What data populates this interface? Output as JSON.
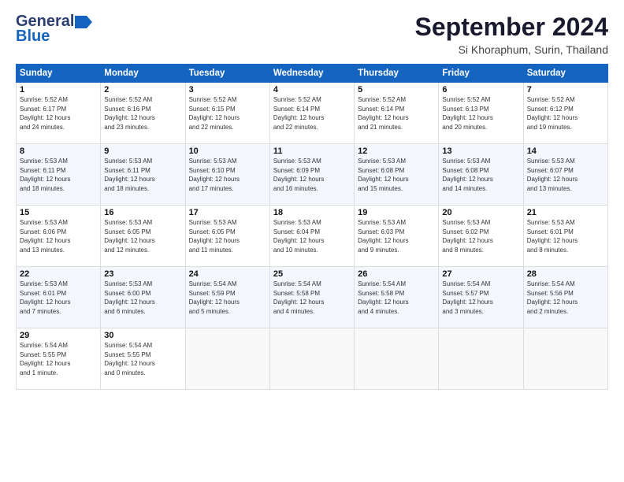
{
  "header": {
    "logo_general": "General",
    "logo_blue": "Blue",
    "month": "September 2024",
    "location": "Si Khoraphum, Surin, Thailand"
  },
  "weekdays": [
    "Sunday",
    "Monday",
    "Tuesday",
    "Wednesday",
    "Thursday",
    "Friday",
    "Saturday"
  ],
  "weeks": [
    [
      {
        "day": "1",
        "sunrise": "5:52 AM",
        "sunset": "6:17 PM",
        "daylight": "12 hours and 24 minutes."
      },
      {
        "day": "2",
        "sunrise": "5:52 AM",
        "sunset": "6:16 PM",
        "daylight": "12 hours and 23 minutes."
      },
      {
        "day": "3",
        "sunrise": "5:52 AM",
        "sunset": "6:15 PM",
        "daylight": "12 hours and 22 minutes."
      },
      {
        "day": "4",
        "sunrise": "5:52 AM",
        "sunset": "6:14 PM",
        "daylight": "12 hours and 22 minutes."
      },
      {
        "day": "5",
        "sunrise": "5:52 AM",
        "sunset": "6:14 PM",
        "daylight": "12 hours and 21 minutes."
      },
      {
        "day": "6",
        "sunrise": "5:52 AM",
        "sunset": "6:13 PM",
        "daylight": "12 hours and 20 minutes."
      },
      {
        "day": "7",
        "sunrise": "5:52 AM",
        "sunset": "6:12 PM",
        "daylight": "12 hours and 19 minutes."
      }
    ],
    [
      {
        "day": "8",
        "sunrise": "5:53 AM",
        "sunset": "6:11 PM",
        "daylight": "12 hours and 18 minutes."
      },
      {
        "day": "9",
        "sunrise": "5:53 AM",
        "sunset": "6:11 PM",
        "daylight": "12 hours and 18 minutes."
      },
      {
        "day": "10",
        "sunrise": "5:53 AM",
        "sunset": "6:10 PM",
        "daylight": "12 hours and 17 minutes."
      },
      {
        "day": "11",
        "sunrise": "5:53 AM",
        "sunset": "6:09 PM",
        "daylight": "12 hours and 16 minutes."
      },
      {
        "day": "12",
        "sunrise": "5:53 AM",
        "sunset": "6:08 PM",
        "daylight": "12 hours and 15 minutes."
      },
      {
        "day": "13",
        "sunrise": "5:53 AM",
        "sunset": "6:08 PM",
        "daylight": "12 hours and 14 minutes."
      },
      {
        "day": "14",
        "sunrise": "5:53 AM",
        "sunset": "6:07 PM",
        "daylight": "12 hours and 13 minutes."
      }
    ],
    [
      {
        "day": "15",
        "sunrise": "5:53 AM",
        "sunset": "6:06 PM",
        "daylight": "12 hours and 13 minutes."
      },
      {
        "day": "16",
        "sunrise": "5:53 AM",
        "sunset": "6:05 PM",
        "daylight": "12 hours and 12 minutes."
      },
      {
        "day": "17",
        "sunrise": "5:53 AM",
        "sunset": "6:05 PM",
        "daylight": "12 hours and 11 minutes."
      },
      {
        "day": "18",
        "sunrise": "5:53 AM",
        "sunset": "6:04 PM",
        "daylight": "12 hours and 10 minutes."
      },
      {
        "day": "19",
        "sunrise": "5:53 AM",
        "sunset": "6:03 PM",
        "daylight": "12 hours and 9 minutes."
      },
      {
        "day": "20",
        "sunrise": "5:53 AM",
        "sunset": "6:02 PM",
        "daylight": "12 hours and 8 minutes."
      },
      {
        "day": "21",
        "sunrise": "5:53 AM",
        "sunset": "6:01 PM",
        "daylight": "12 hours and 8 minutes."
      }
    ],
    [
      {
        "day": "22",
        "sunrise": "5:53 AM",
        "sunset": "6:01 PM",
        "daylight": "12 hours and 7 minutes."
      },
      {
        "day": "23",
        "sunrise": "5:53 AM",
        "sunset": "6:00 PM",
        "daylight": "12 hours and 6 minutes."
      },
      {
        "day": "24",
        "sunrise": "5:54 AM",
        "sunset": "5:59 PM",
        "daylight": "12 hours and 5 minutes."
      },
      {
        "day": "25",
        "sunrise": "5:54 AM",
        "sunset": "5:58 PM",
        "daylight": "12 hours and 4 minutes."
      },
      {
        "day": "26",
        "sunrise": "5:54 AM",
        "sunset": "5:58 PM",
        "daylight": "12 hours and 4 minutes."
      },
      {
        "day": "27",
        "sunrise": "5:54 AM",
        "sunset": "5:57 PM",
        "daylight": "12 hours and 3 minutes."
      },
      {
        "day": "28",
        "sunrise": "5:54 AM",
        "sunset": "5:56 PM",
        "daylight": "12 hours and 2 minutes."
      }
    ],
    [
      {
        "day": "29",
        "sunrise": "5:54 AM",
        "sunset": "5:55 PM",
        "daylight": "12 hours and 1 minute."
      },
      {
        "day": "30",
        "sunrise": "5:54 AM",
        "sunset": "5:55 PM",
        "daylight": "12 hours and 0 minutes."
      },
      null,
      null,
      null,
      null,
      null
    ]
  ]
}
